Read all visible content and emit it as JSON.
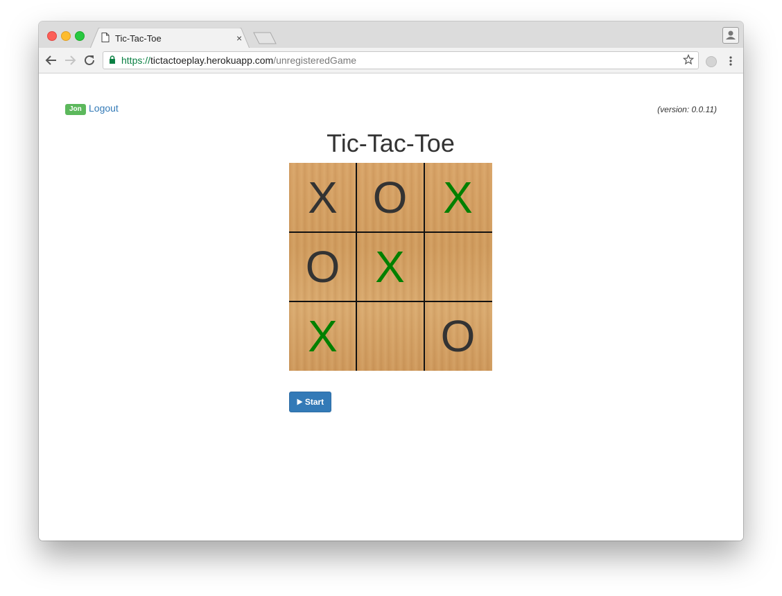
{
  "browser": {
    "tab_title": "Tic-Tac-Toe",
    "tab_close_glyph": "×",
    "url_scheme": "https://",
    "url_host": "tictactoeplay.herokuapp.com",
    "url_path": "/unregisteredGame"
  },
  "header": {
    "user_badge": "Jon",
    "logout_label": "Logout",
    "version_text": "(version: 0.0.11)"
  },
  "game": {
    "title": "Tic-Tac-Toe",
    "board": [
      {
        "mark": "X",
        "color": "#333333"
      },
      {
        "mark": "O",
        "color": "#333333"
      },
      {
        "mark": "X",
        "color": "#008000"
      },
      {
        "mark": "O",
        "color": "#333333"
      },
      {
        "mark": "X",
        "color": "#008000"
      },
      {
        "mark": "",
        "color": "#333333"
      },
      {
        "mark": "X",
        "color": "#008000"
      },
      {
        "mark": "",
        "color": "#333333"
      },
      {
        "mark": "O",
        "color": "#333333"
      }
    ],
    "start_label": "Start",
    "start_icon": "play-icon"
  },
  "colors": {
    "badge_green": "#5cb85c",
    "link_blue": "#337ab7",
    "button_blue": "#337ab7",
    "winning_mark": "#008000"
  }
}
